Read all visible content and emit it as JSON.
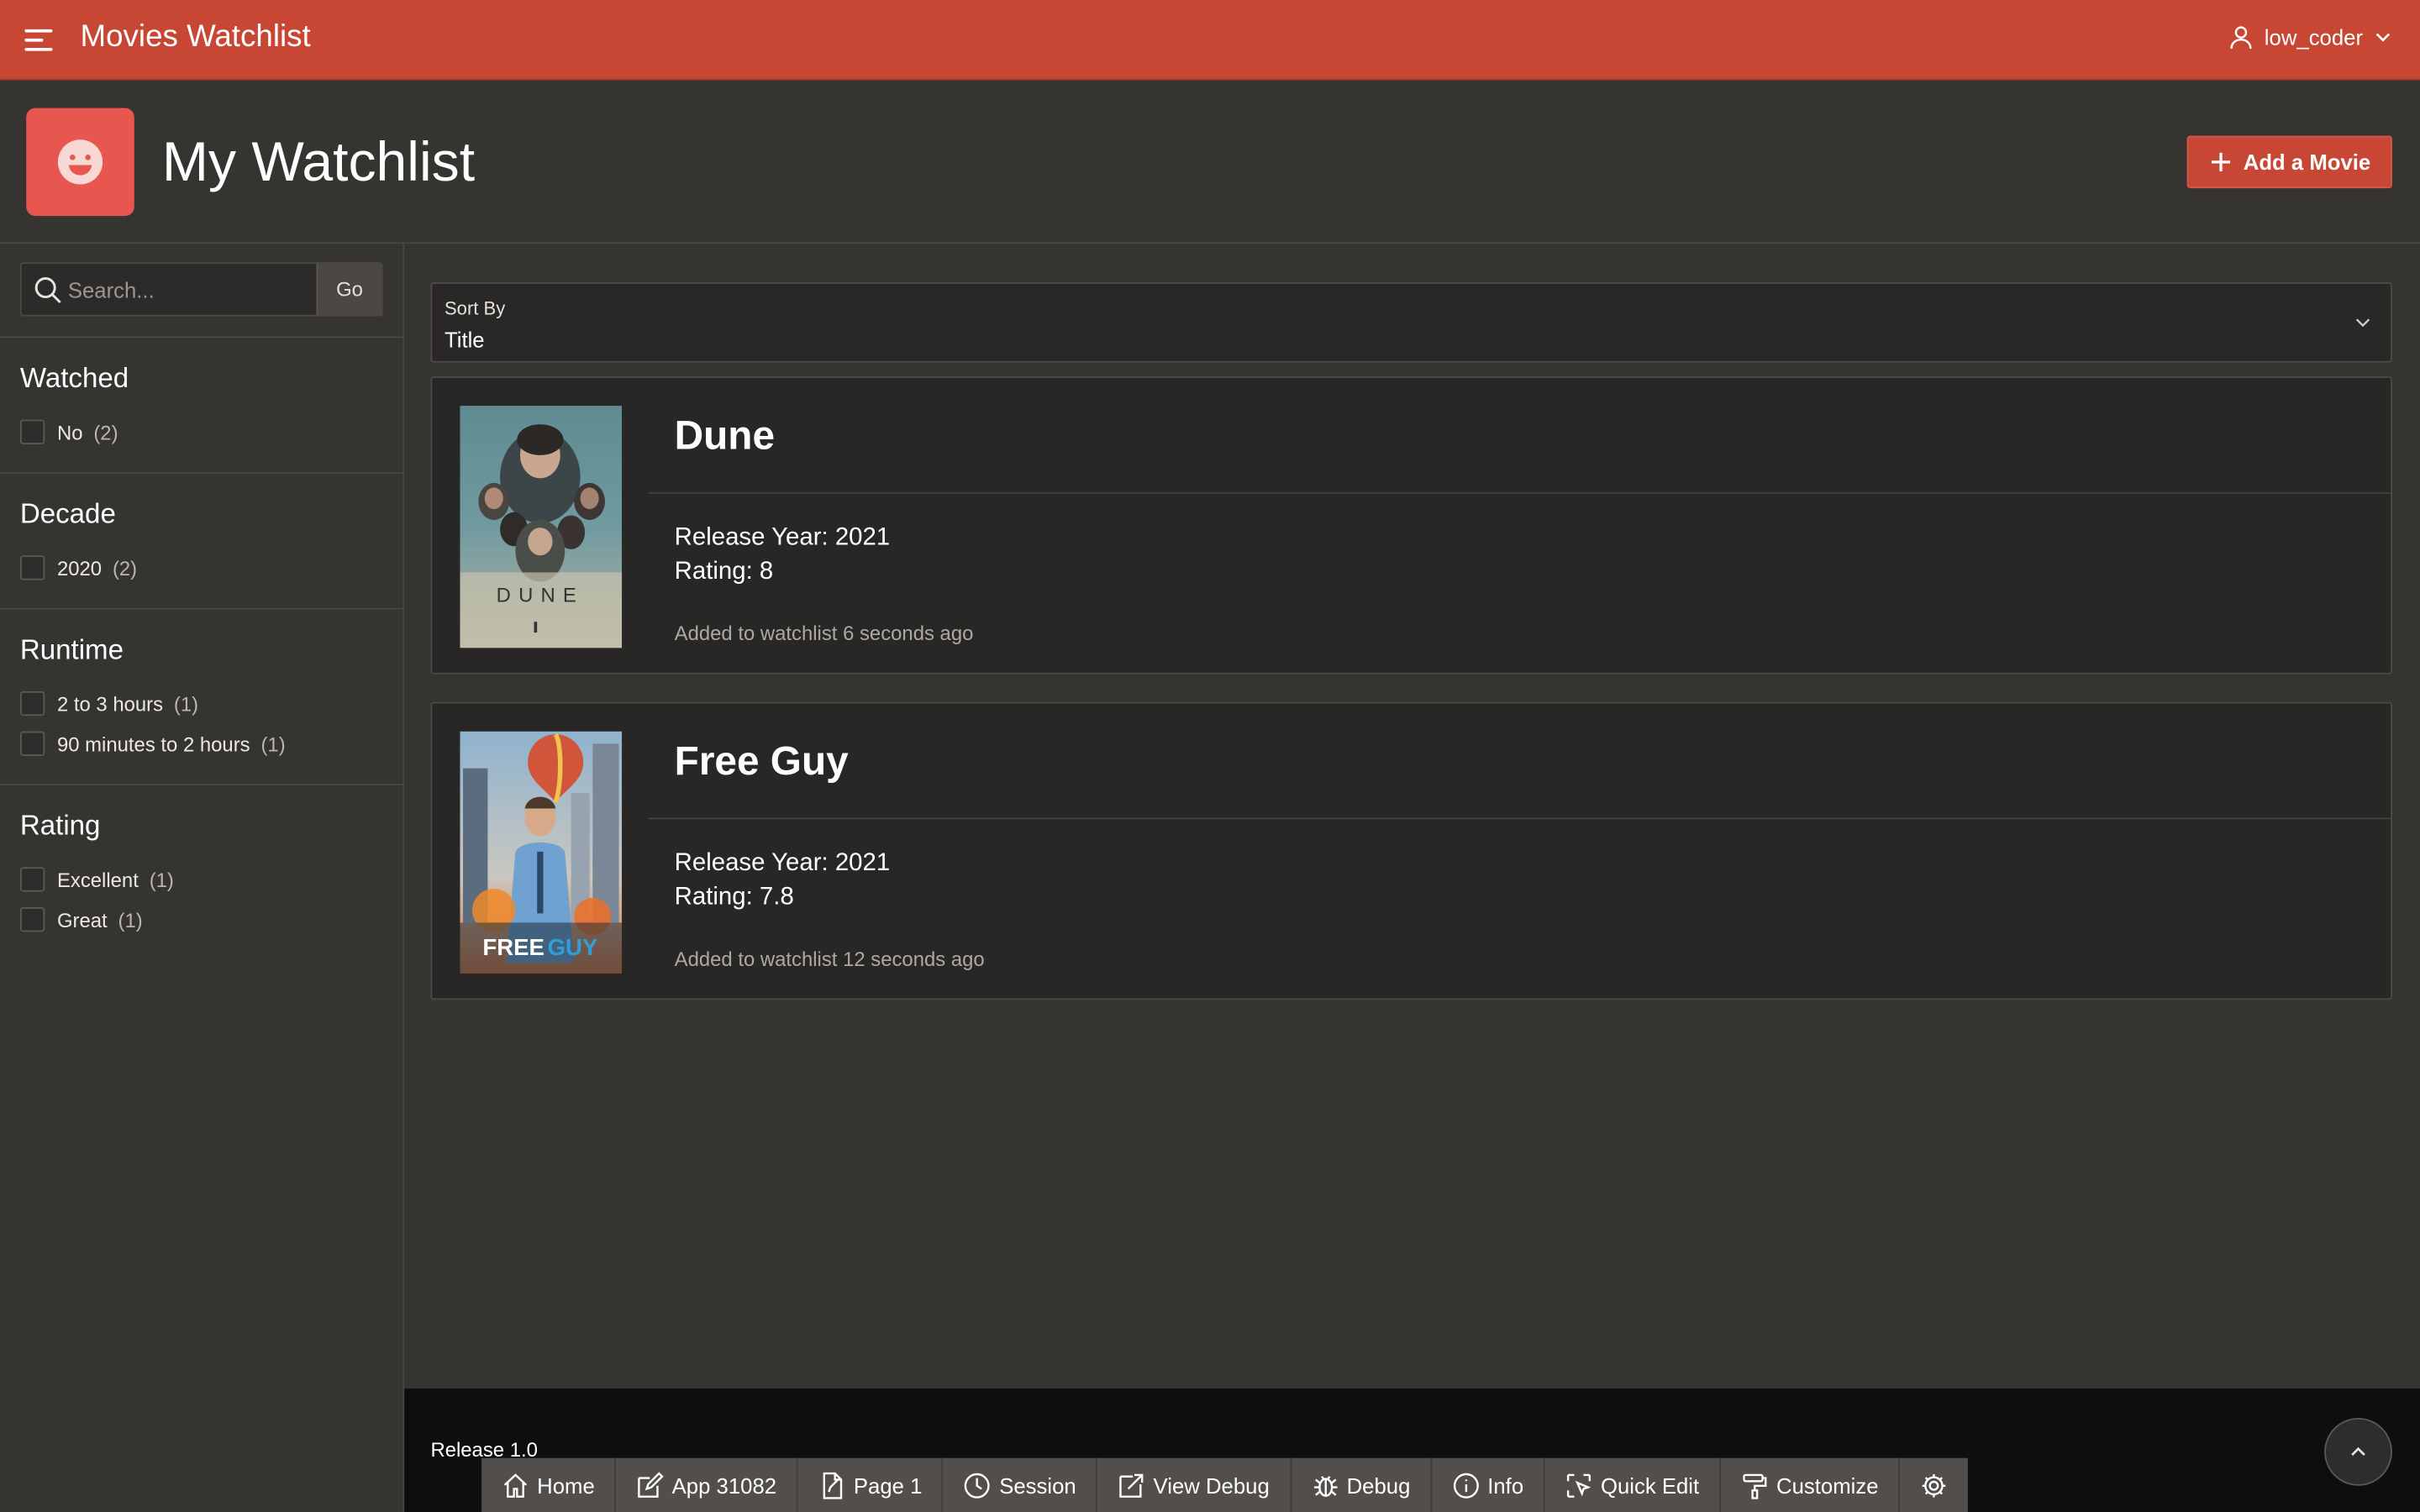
{
  "header": {
    "app_title": "Movies Watchlist",
    "user": "low_coder"
  },
  "hero": {
    "title": "My Watchlist",
    "add_button": "Add a Movie"
  },
  "search": {
    "placeholder": "Search...",
    "go": "Go"
  },
  "facets": {
    "watched": {
      "title": "Watched",
      "options": [
        {
          "label": "No",
          "count": "(2)"
        }
      ]
    },
    "decade": {
      "title": "Decade",
      "options": [
        {
          "label": "2020",
          "count": "(2)"
        }
      ]
    },
    "runtime": {
      "title": "Runtime",
      "options": [
        {
          "label": "2 to 3 hours",
          "count": "(1)"
        },
        {
          "label": "90 minutes to 2 hours",
          "count": "(1)"
        }
      ]
    },
    "rating": {
      "title": "Rating",
      "options": [
        {
          "label": "Excellent",
          "count": "(1)"
        },
        {
          "label": "Great",
          "count": "(1)"
        }
      ]
    }
  },
  "sort": {
    "label": "Sort By",
    "value": "Title"
  },
  "movies": [
    {
      "title": "Dune",
      "release": "Release Year: 2021",
      "rating": "Rating: 8",
      "added": "Added to watchlist 6 seconds ago",
      "poster_text": "DUNE"
    },
    {
      "title": "Free Guy",
      "release": "Release Year: 2021",
      "rating": "Rating: 7.8",
      "added": "Added to watchlist 12 seconds ago",
      "poster_text_1": "FREE",
      "poster_text_2": "GUY"
    }
  ],
  "footer": {
    "release": "Release 1.0"
  },
  "devbar": {
    "home": "Home",
    "app": "App 31082",
    "page": "Page 1",
    "session": "Session",
    "view_debug": "View Debug",
    "debug": "Debug",
    "info": "Info",
    "quick_edit": "Quick Edit",
    "customize": "Customize"
  },
  "colors": {
    "header": "#c74634",
    "accent_icon": "#e8574f",
    "background": "#363431",
    "footer": "#0e0e0e"
  }
}
